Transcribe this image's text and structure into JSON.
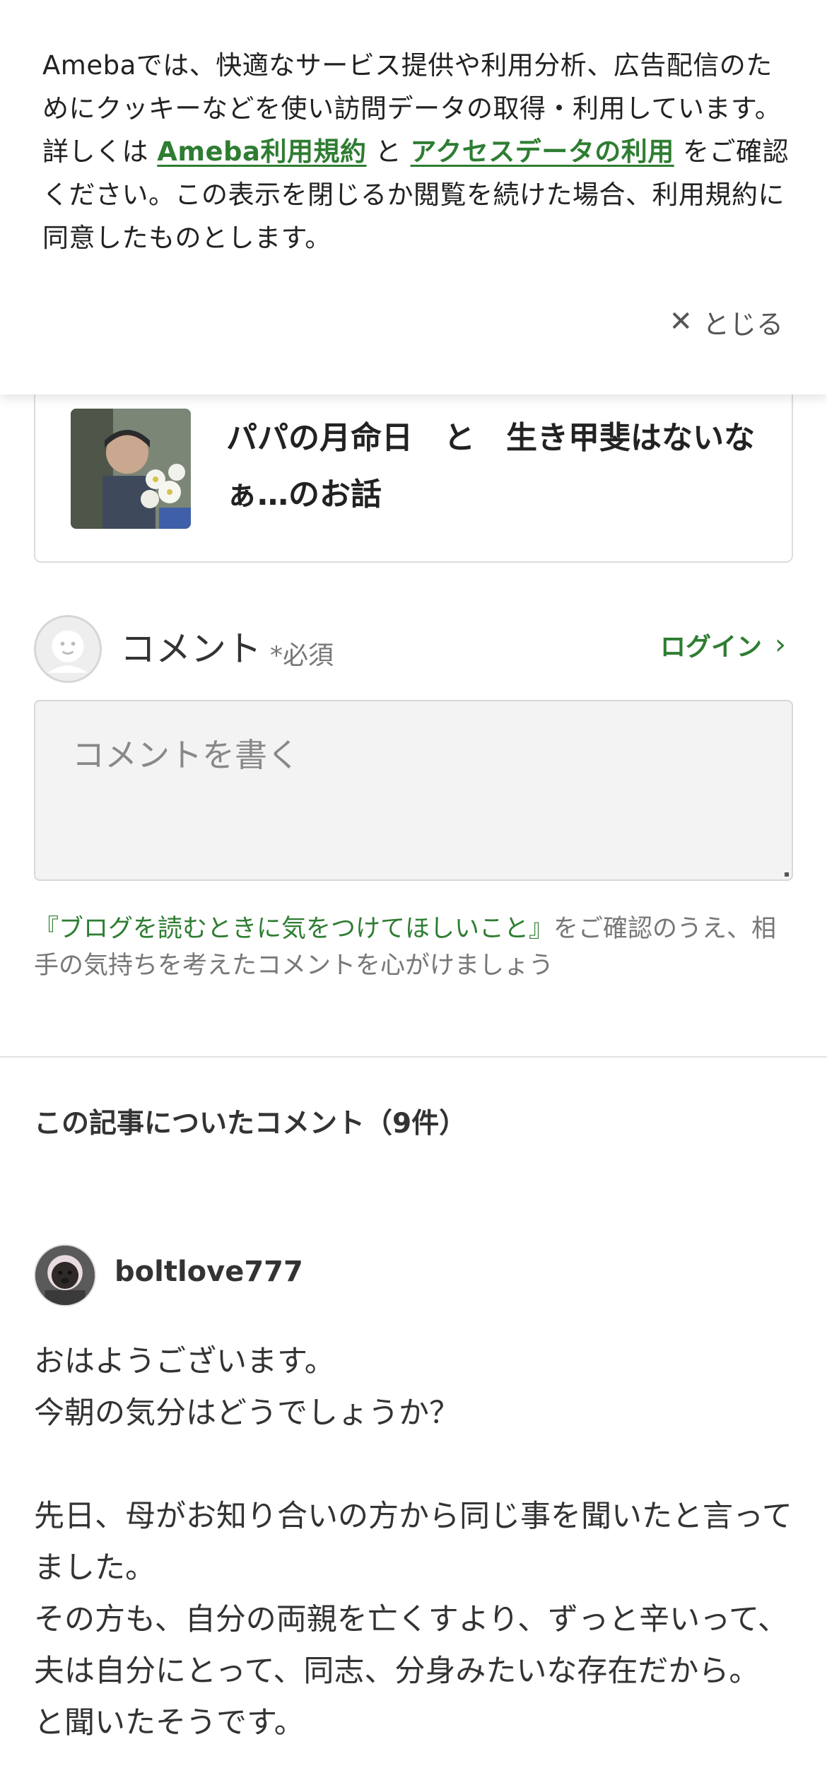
{
  "cookie_banner": {
    "text_before": "Amebaでは、快適なサービス提供や利用分析、広告配信のためにクッキーなどを使い訪問データの取得・利用しています。詳しくは ",
    "link_terms": "Ameba利用規約",
    "text_and": " と ",
    "link_access": "アクセスデータの利用",
    "text_after": " をご確認ください。この表示を閉じるか閲覧を続けた場合、利用規約に同意したものとします。",
    "close_label": "とじる"
  },
  "article": {
    "title": "パパの月命日　と　生き甲斐はないなぁ…のお話"
  },
  "comment_form": {
    "heading": "コメント",
    "required_label": "*必須",
    "login_label": "ログイン",
    "placeholder": "コメントを書く",
    "guideline_link": "『ブログを読むときに気をつけてほしいこと』",
    "guideline_text": "をご確認のうえ、相手の気持ちを考えたコメントを心がけましょう"
  },
  "comments_section": {
    "title": "この記事についたコメント（9件）"
  },
  "comments": [
    {
      "user": "boltlove777",
      "body": "おはようございます。\n今朝の気分はどうでしょうか？\n\n先日、母がお知り合いの方から同じ事を聞いたと言ってました。\nその方も、自分の両親を亡くすより、ずっと辛いって、夫は自分にとって、同志、分身みたいな存在だから。\nと聞いたそうです。"
    }
  ],
  "colors": {
    "accent_green": "#2e7d32",
    "text_primary": "#333333",
    "text_muted": "#777777"
  }
}
